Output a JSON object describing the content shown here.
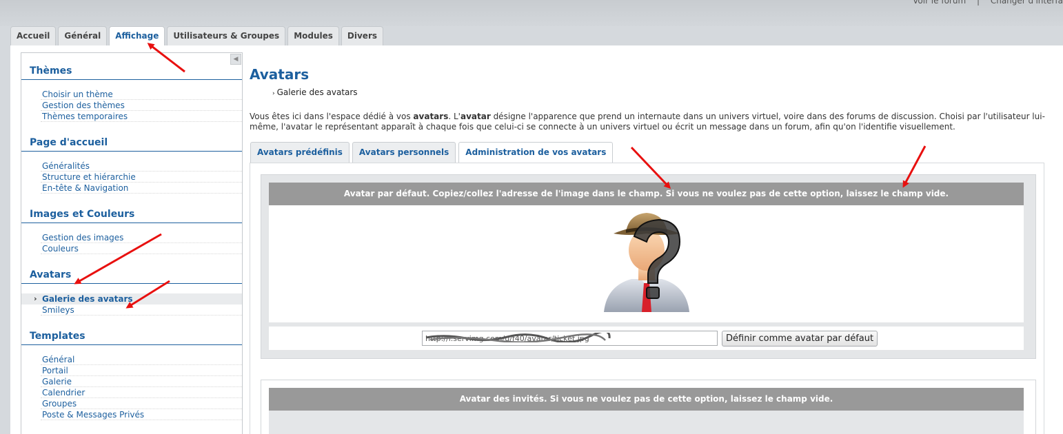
{
  "toplinks": [
    "Voir le forum",
    "|",
    "Changer d'interfa"
  ],
  "main_tabs": [
    "Accueil",
    "Général",
    "Affichage",
    "Utilisateurs & Groupes",
    "Modules",
    "Divers"
  ],
  "sidebar": {
    "collapse_icon": "◀",
    "sections": [
      {
        "title": "Thèmes",
        "items": [
          "Choisir un thème",
          "Gestion des thèmes",
          "Thèmes temporaires"
        ]
      },
      {
        "title": "Page d'accueil",
        "items": [
          "Généralités",
          "Structure et hiérarchie",
          "En-tête & Navigation"
        ]
      },
      {
        "title": "Images et Couleurs",
        "items": [
          "Gestion des images",
          "Couleurs"
        ]
      },
      {
        "title": "Avatars",
        "items": [
          "Galerie des avatars",
          "Smileys"
        ]
      },
      {
        "title": "Templates",
        "items": [
          "Général",
          "Portail",
          "Galerie",
          "Calendrier",
          "Groupes",
          "Poste & Messages Privés"
        ]
      }
    ]
  },
  "main": {
    "title": "Avatars",
    "breadcrumb": "Galerie des avatars",
    "intro_parts": [
      "Vous êtes ici dans l'espace dédié à vos ",
      "avatars",
      ". L'",
      "avatar",
      " désigne l'apparence que prend un internaute dans un univers virtuel, voire dans des forums de discussion. Choisi par l'utilisateur lui-même, l'avatar le représentant apparaît à chaque fois que celui-ci se connecte à un univers virtuel ou écrit un message dans un forum, afin qu'on l'identifie visuellement."
    ],
    "sub_tabs": [
      "Avatars prédéfinis",
      "Avatars personnels",
      "Administration de vos avatars"
    ],
    "block1_header": "Avatar par défaut. Copiez/collez l'adresse de l'image dans le champ. Si vous ne voulez pas de cette option, laissez le champ vide.",
    "url_value": "http://i.servimg.com/u/f40/avatar/ticket.jpg",
    "set_default_button": "Définir comme avatar par défaut",
    "block2_header": "Avatar des invités. Si vous ne voulez pas de cette option, laissez le champ vide."
  },
  "colors": {
    "accent": "#1c5f9e",
    "annotation": "#e8100f"
  }
}
